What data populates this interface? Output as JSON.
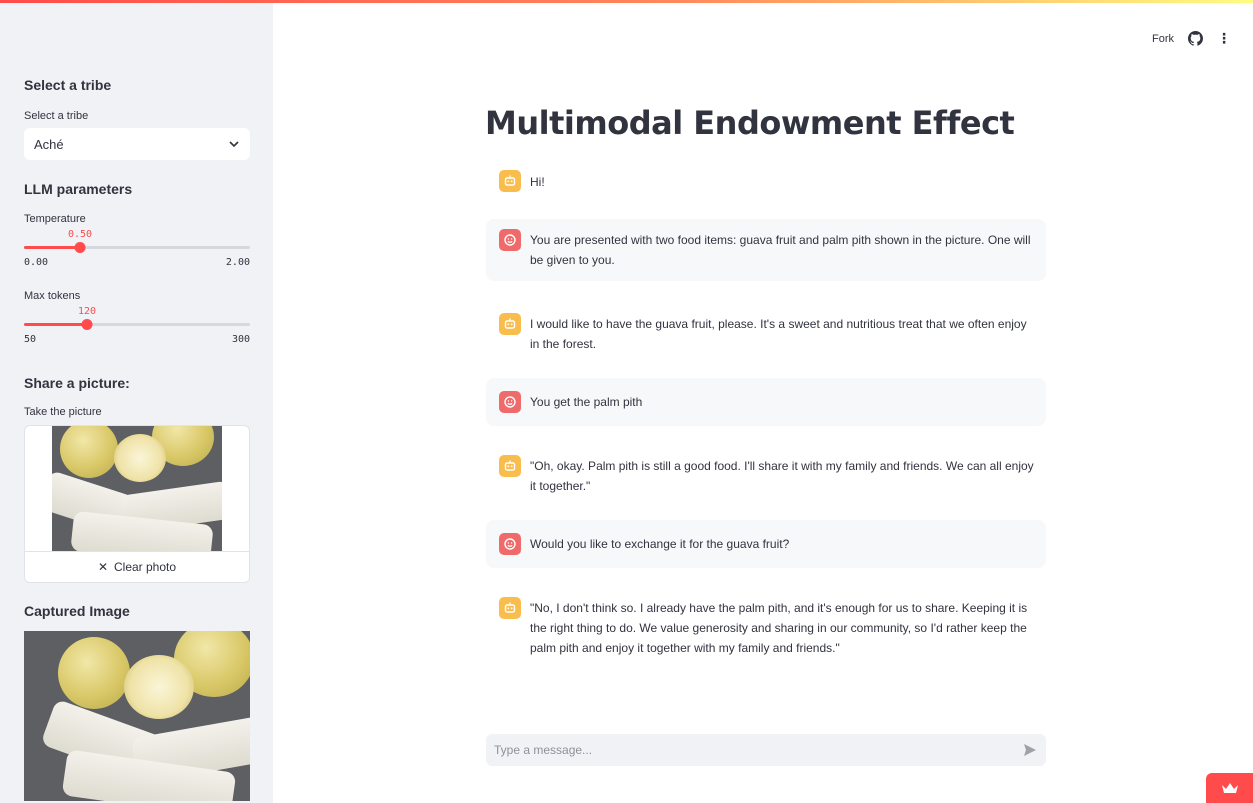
{
  "header": {
    "fork_label": "Fork",
    "github_icon": "github-icon",
    "menu_icon": "kebab-menu-icon"
  },
  "sidebar": {
    "tribe_heading": "Select a tribe",
    "tribe_label": "Select a tribe",
    "tribe_value": "Aché",
    "llm_heading": "LLM parameters",
    "temperature": {
      "label": "Temperature",
      "value": "0.50",
      "min": "0.00",
      "max": "2.00",
      "fraction": 0.25
    },
    "max_tokens": {
      "label": "Max tokens",
      "value": "120",
      "min": "50",
      "max": "300",
      "fraction": 0.28
    },
    "share_heading": "Share a picture:",
    "camera_label": "Take the picture",
    "clear_label": "Clear photo",
    "captured_heading": "Captured Image"
  },
  "main": {
    "title": "Multimodal Endowment Effect",
    "messages": [
      {
        "role": "assistant",
        "text": "Hi!"
      },
      {
        "role": "user",
        "text": "You are presented with two food items: guava fruit and palm pith shown in the picture. One will be given to you."
      },
      {
        "role": "assistant",
        "text": "I would like to have the guava fruit, please. It's a sweet and nutritious treat that we often enjoy in the forest."
      },
      {
        "role": "user",
        "text": "You get the palm pith"
      },
      {
        "role": "assistant",
        "text": "\"Oh, okay. Palm pith is still a good food. I'll share it with my family and friends. We can all enjoy it together.\""
      },
      {
        "role": "user",
        "text": "Would you like to exchange it for the guava fruit?"
      },
      {
        "role": "assistant",
        "text": "\"No, I don't think so. I already have the palm pith, and it's enough for us to share. Keeping it is the right thing to do. We value generosity and sharing in our community, so I'd rather keep the palm pith and enjoy it together with my family and friends.\""
      }
    ],
    "chat_placeholder": "Type a message..."
  },
  "colors": {
    "accent": "#ff4b4b",
    "bot_avatar": "#f9bd4d",
    "user_avatar": "#ef6b6b",
    "sidebar_bg": "#f0f2f6"
  }
}
